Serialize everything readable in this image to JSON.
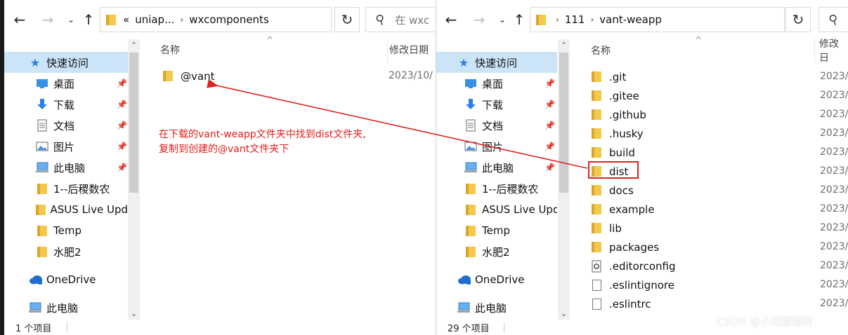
{
  "left": {
    "breadcrumb": [
      "uniap...",
      "wxcomponents"
    ],
    "breadcrumb_prefix": "«",
    "search_placeholder": "在 wxc",
    "nav": [
      {
        "label": "快速访问",
        "icon": "star-icon",
        "selected": true
      },
      {
        "label": "桌面",
        "icon": "desktop-icon",
        "pinned": true
      },
      {
        "label": "下载",
        "icon": "download-icon",
        "pinned": true
      },
      {
        "label": "文档",
        "icon": "document-icon",
        "pinned": true
      },
      {
        "label": "图片",
        "icon": "picture-icon",
        "pinned": true
      },
      {
        "label": "此电脑",
        "icon": "computer-icon",
        "pinned": true
      },
      {
        "label": "1--后稷数农",
        "icon": "folder-icon"
      },
      {
        "label": "ASUS Live Upd",
        "icon": "folder-icon"
      },
      {
        "label": "Temp",
        "icon": "folder-icon"
      },
      {
        "label": "水肥2",
        "icon": "folder-icon"
      },
      {
        "label": "OneDrive",
        "icon": "cloud-icon"
      },
      {
        "label": "此电脑",
        "icon": "computer-icon"
      }
    ],
    "col_name": "名称",
    "col_date": "修改日期",
    "files": [
      {
        "name": "@vant",
        "date": "2023/10/",
        "type": "folder"
      }
    ],
    "status": "1 个项目"
  },
  "right": {
    "breadcrumb": [
      "111",
      "vant-weapp"
    ],
    "nav": [
      {
        "label": "快速访问",
        "icon": "star-icon",
        "selected": true
      },
      {
        "label": "桌面",
        "icon": "desktop-icon",
        "pinned": true
      },
      {
        "label": "下载",
        "icon": "download-icon",
        "pinned": true
      },
      {
        "label": "文档",
        "icon": "document-icon",
        "pinned": true
      },
      {
        "label": "图片",
        "icon": "picture-icon",
        "pinned": true
      },
      {
        "label": "此电脑",
        "icon": "computer-icon",
        "pinned": true
      },
      {
        "label": "1--后稷数农",
        "icon": "folder-icon"
      },
      {
        "label": "ASUS Live Upd",
        "icon": "folder-icon"
      },
      {
        "label": "Temp",
        "icon": "folder-icon"
      },
      {
        "label": "水肥2",
        "icon": "folder-icon"
      },
      {
        "label": "OneDrive",
        "icon": "cloud-icon"
      },
      {
        "label": "此电脑",
        "icon": "computer-icon"
      }
    ],
    "col_name": "名称",
    "col_date": "修改日",
    "files": [
      {
        "name": ".git",
        "date": "2023/",
        "type": "folder"
      },
      {
        "name": ".gitee",
        "date": "2023/",
        "type": "folder"
      },
      {
        "name": ".github",
        "date": "2023/",
        "type": "folder"
      },
      {
        "name": ".husky",
        "date": "2023/",
        "type": "folder"
      },
      {
        "name": "build",
        "date": "2023/",
        "type": "folder"
      },
      {
        "name": "dist",
        "date": "2023/",
        "type": "folder",
        "highlight": true
      },
      {
        "name": "docs",
        "date": "2023/",
        "type": "folder"
      },
      {
        "name": "example",
        "date": "2023/",
        "type": "folder"
      },
      {
        "name": "lib",
        "date": "2023/",
        "type": "folder"
      },
      {
        "name": "packages",
        "date": "2023/",
        "type": "folder"
      },
      {
        "name": ".editorconfig",
        "date": "2023/",
        "type": "config"
      },
      {
        "name": ".eslintignore",
        "date": "2023/",
        "type": "file"
      },
      {
        "name": ".eslintrc",
        "date": "2023/",
        "type": "file"
      }
    ],
    "status": "29 个项目"
  },
  "annotation": {
    "line1": "在下载的vant-weapp文件夹中找到dist文件夹,",
    "line2": "复制到创建的@vant文件夹下",
    "color": "#e0201c"
  },
  "watermark": "CSDN @小羽爱搬砖"
}
